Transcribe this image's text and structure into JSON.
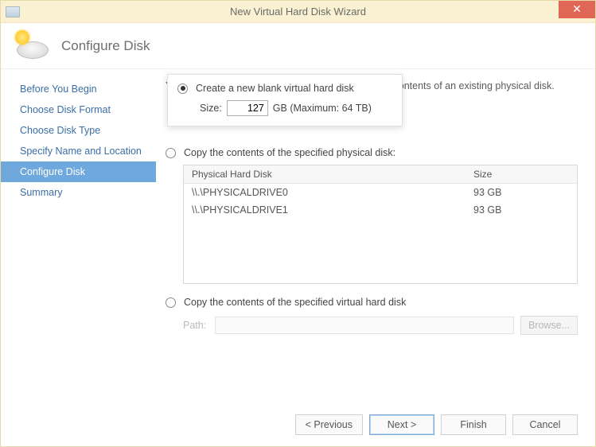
{
  "window": {
    "title": "New Virtual Hard Disk Wizard"
  },
  "header": {
    "title": "Configure Disk"
  },
  "sidebar": {
    "items": [
      {
        "label": "Before You Begin"
      },
      {
        "label": "Choose Disk Format"
      },
      {
        "label": "Choose Disk Type"
      },
      {
        "label": "Specify Name and Location"
      },
      {
        "label": "Configure Disk"
      },
      {
        "label": "Summary"
      }
    ],
    "active_index": 4
  },
  "main": {
    "intro": "You can create a blank virtual hard disk or copy the contents of an existing physical disk.",
    "options": {
      "create_blank": {
        "label": "Create a new blank virtual hard disk",
        "checked": true,
        "size_label": "Size:",
        "size_value": "127",
        "size_unit_suffix": "GB (Maximum: 64 TB)"
      },
      "copy_physical": {
        "label": "Copy the contents of the specified physical disk:",
        "checked": false,
        "table": {
          "headers": {
            "name": "Physical Hard Disk",
            "size": "Size"
          },
          "rows": [
            {
              "name": "\\\\.\\PHYSICALDRIVE0",
              "size": "93 GB"
            },
            {
              "name": "\\\\.\\PHYSICALDRIVE1",
              "size": "93 GB"
            }
          ]
        }
      },
      "copy_virtual": {
        "label": "Copy the contents of the specified virtual hard disk",
        "checked": false,
        "path_label": "Path:",
        "path_value": "",
        "browse_label": "Browse..."
      }
    }
  },
  "footer": {
    "previous": "< Previous",
    "next": "Next >",
    "finish": "Finish",
    "cancel": "Cancel"
  }
}
